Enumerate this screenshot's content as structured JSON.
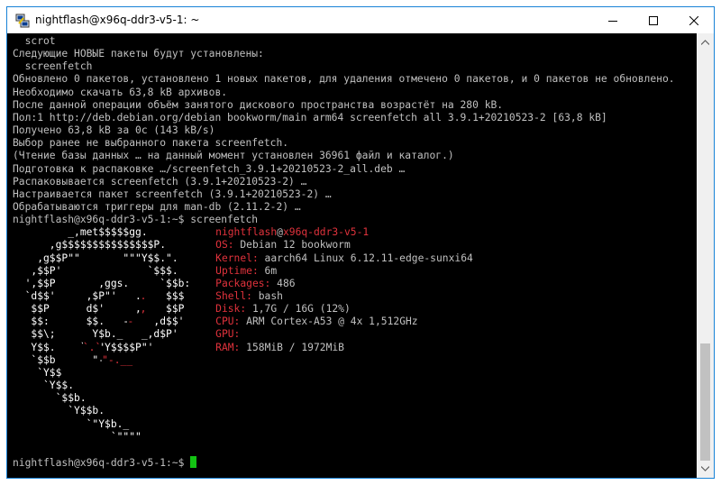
{
  "window": {
    "title": "nightflash@x96q-ddr3-v5-1: ~",
    "app_icon": "putty-icon",
    "controls": [
      "minimize-icon",
      "maximize-icon",
      "close-icon"
    ]
  },
  "terminal": {
    "output": [
      "  scrot",
      "Следующие НОВЫЕ пакеты будут установлены:",
      "  screenfetch",
      "Обновлено 0 пакетов, установлено 1 новых пакетов, для удаления отмечено 0 пакетов, и 0 пакетов не обновлено.",
      "Необходимо скачать 63,8 kB архивов.",
      "После данной операции объём занятого дискового пространства возрастёт на 280 kB.",
      "Пол:1 http://deb.debian.org/debian bookworm/main arm64 screenfetch all 3.9.1+20210523-2 [63,8 kB]",
      "Получено 63,8 kB за 0с (143 kB/s)",
      "Выбор ранее не выбранного пакета screenfetch.",
      "(Чтение базы данных … на данный момент установлен 36961 файл и каталог.)",
      "Подготовка к распаковке …/screenfetch_3.9.1+20210523-2_all.deb …",
      "Распаковывается screenfetch (3.9.1+20210523-2) …",
      "Настраивается пакет screenfetch (3.9.1+20210523-2) …",
      "Обрабатываются триггеры для man-db (2.11.2-2) …",
      "nightflash@x96q-ddr3-v5-1:~$ screenfetch"
    ],
    "logo": [
      "         _,met$$$$$gg.",
      "      ,g$$$$$$$$$$$$$$$P.",
      "    ,g$$P\"\"       \"\"\"Y$$.\".",
      "   ,$$P'              `$$$.",
      "  ',$$P       ,ggs.     `$$b:",
      "  `d$$'     ,$P\"'   .    $$$",
      "   $$P      d$'     ,    $$P",
      "   $$:      $$.   -    ,d$$'",
      "   $$\\;      Y$b._   _,d$P'",
      "   Y$$.    `.`\"Y$$$$P\"'",
      "   `$$b      \"-.__",
      "    `Y$$",
      "     `Y$$.",
      "       `$$b.",
      "         `Y$$b.",
      "            `\"Y$b._",
      "                `\"\"\"\""
    ],
    "logo_red_marks": [
      {
        "row": 5,
        "col": 20,
        "text": "."
      },
      {
        "row": 6,
        "col": 20,
        "text": ","
      },
      {
        "row": 7,
        "col": 18,
        "text": "-"
      },
      {
        "row": 9,
        "col": 11,
        "text": "`.`"
      },
      {
        "row": 10,
        "col": 14,
        "text": "\"-.__"
      }
    ],
    "sysinfo": {
      "user": "nightflash",
      "at": "@",
      "host": "x96q-ddr3-v5-1",
      "fields": [
        {
          "label": "OS:",
          "value": " Debian 12 bookworm"
        },
        {
          "label": "Kernel:",
          "value": " aarch64 Linux 6.12.11-edge-sunxi64"
        },
        {
          "label": "Uptime:",
          "value": " 6m"
        },
        {
          "label": "Packages:",
          "value": " 486"
        },
        {
          "label": "Shell:",
          "value": " bash"
        },
        {
          "label": "Disk:",
          "value": " 1,7G / 16G (12%)"
        },
        {
          "label": "CPU:",
          "value": " ARM Cortex-A53 @ 4x 1,512GHz"
        },
        {
          "label": "GPU:",
          "value": ""
        },
        {
          "label": "RAM:",
          "value": " 158MiB / 1972MiB"
        }
      ]
    },
    "final_prompt": "nightflash@x96q-ddr3-v5-1:~$ ",
    "colors": {
      "background": "#000000",
      "text": "#c0c0c0",
      "logo": "#ffffff",
      "accent_red": "#e0323c",
      "cursor": "#13c313"
    }
  }
}
